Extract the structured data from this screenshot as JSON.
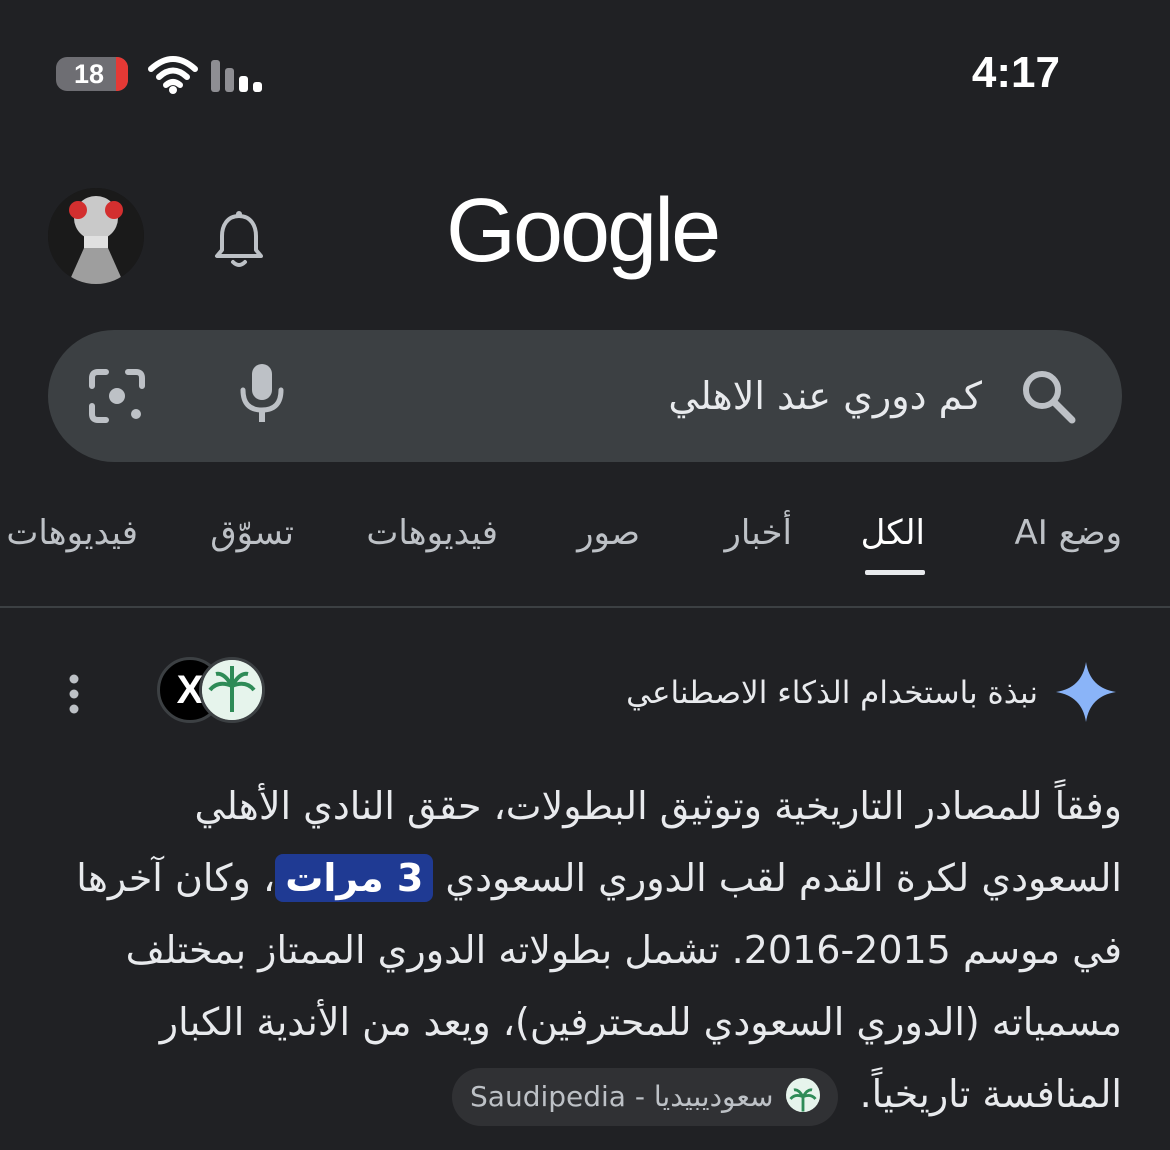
{
  "status_bar": {
    "time": "4:17",
    "battery": "18",
    "battery_color": "#e53935"
  },
  "header": {
    "logo_text": "Google",
    "avatar_icon": "profile-avatar",
    "bell_icon": "bell-icon"
  },
  "search": {
    "query": "كم دوري عند الاهلي"
  },
  "tabs": [
    {
      "label": "وضع AI"
    },
    {
      "label": "الكل",
      "active": true
    },
    {
      "label": "أخبار"
    },
    {
      "label": "صور"
    },
    {
      "label": "فيديوهات"
    },
    {
      "label": "تسوّق"
    },
    {
      "label": "فيديوهات"
    }
  ],
  "ai_overview": {
    "title": "نبذة باستخدام الذكاء الاصطناعي",
    "source_icons": [
      "x-icon",
      "saudipedia-icon"
    ],
    "body_part1": "وفقاً للمصادر التاريخية وتوثيق البطولات، حقق النادي الأهلي السعودي لكرة القدم لقب الدوري السعودي ",
    "highlight": "3 مرات",
    "body_part2": "، وكان آخرها في موسم 2015-2016. تشمل بطولاته الدوري الممتاز بمختلف مسمياته (الدوري السعودي للمحترفين)، ويعد من الأندية الكبار المنافسة تاريخياً.",
    "source_chip": "سعودیبیدیا - Saudipedia",
    "accent_color": "#8ab4f8",
    "highlight_color": "#1f3a93"
  }
}
